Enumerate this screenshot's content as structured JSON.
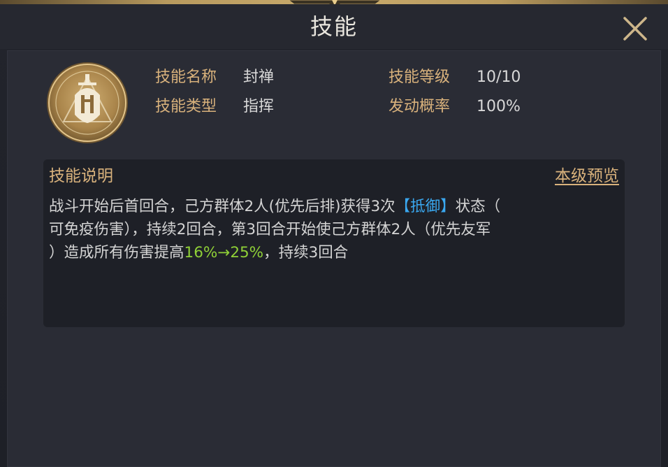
{
  "window": {
    "title": "技能"
  },
  "skill": {
    "name_label": "技能名称",
    "name_value": "封禅",
    "type_label": "技能类型",
    "type_value": "指挥",
    "level_label": "技能等级",
    "level_value": "10/10",
    "chance_label": "发动概率",
    "chance_value": "100%"
  },
  "description": {
    "title": "技能说明",
    "preview_label": "本级预览",
    "line1_text": "战斗开始后首回合，己方群体2人(优先后排)获得3次",
    "line1_keyword": "【抵御】",
    "line1_tail": "状态（",
    "line2_text": "可免疫伤害），持续2回合，第3回合开始使己方群体2人（优先友军",
    "line3_head": "）造成所有伤害提高",
    "line3_value": "16%→25%",
    "line3_tail": "，持续3回合"
  },
  "colors": {
    "gold_label": "#d9b27c",
    "keyword_blue": "#3aa8f0",
    "value_green": "#8fd037",
    "text_main": "#d4d4d4"
  },
  "icons": {
    "close": "close-icon",
    "skill": "sword-helmet-skill-icon"
  }
}
